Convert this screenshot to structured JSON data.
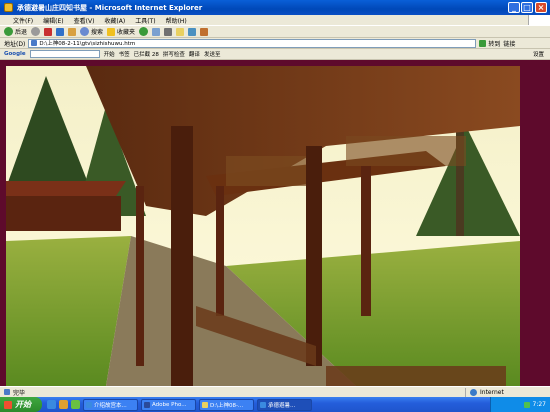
{
  "window": {
    "title": "承德避暑山庄四知书屋 - Microsoft Internet Explorer"
  },
  "menu": [
    "文件(F)",
    "编辑(E)",
    "查看(V)",
    "收藏(A)",
    "工具(T)",
    "帮助(H)"
  ],
  "toolbar": {
    "back": "后退",
    "search": "搜索",
    "favorites": "收藏夹"
  },
  "address": {
    "label": "地址(D)",
    "value": "D:\\上神08-2-11\\gtv\\sizhishuwu.htm",
    "go": "转到",
    "links": "链接"
  },
  "google": {
    "label": "Google",
    "go": "开始",
    "bookmarks": "书签",
    "blocked": "已拦截 28",
    "check": "拼写检查",
    "translate": "翻译",
    "send": "发送至",
    "settings": "设置"
  },
  "status": {
    "left": "完毕",
    "zone": "Internet"
  },
  "taskbar": {
    "start": "开始",
    "tasks": [
      "介绍故宫本...",
      "Adobe Pho...",
      "D:\\上神08-...",
      "承德避暑..."
    ],
    "clock": "7:27"
  },
  "colors": {
    "page_background": "#5e0a2c"
  }
}
